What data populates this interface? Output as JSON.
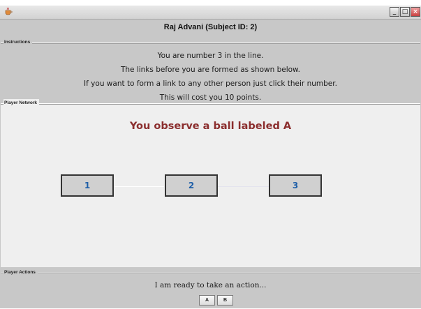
{
  "window": {
    "icon": "java-cup-icon",
    "controls": [
      "minimize",
      "maximize",
      "close"
    ]
  },
  "subject_name": "Raj Advani (Subject ID: 2)",
  "instructions": {
    "title": "Instructions",
    "lines": [
      "You are number 3 in the line.",
      "The links before you are formed as shown below.",
      "If you want to form a link to any other person just click their number.",
      "This will cost you 10 points."
    ]
  },
  "network": {
    "title": "Player Network",
    "observation": "You observe a ball labeled A",
    "observation_color": "#8b2e2e",
    "players": [
      "1",
      "2",
      "3"
    ],
    "player_number_color": "#1f5fa8"
  },
  "actions": {
    "title": "Player Actions",
    "prompt": "I am ready to take an action...",
    "buttons": [
      "A",
      "B"
    ]
  }
}
